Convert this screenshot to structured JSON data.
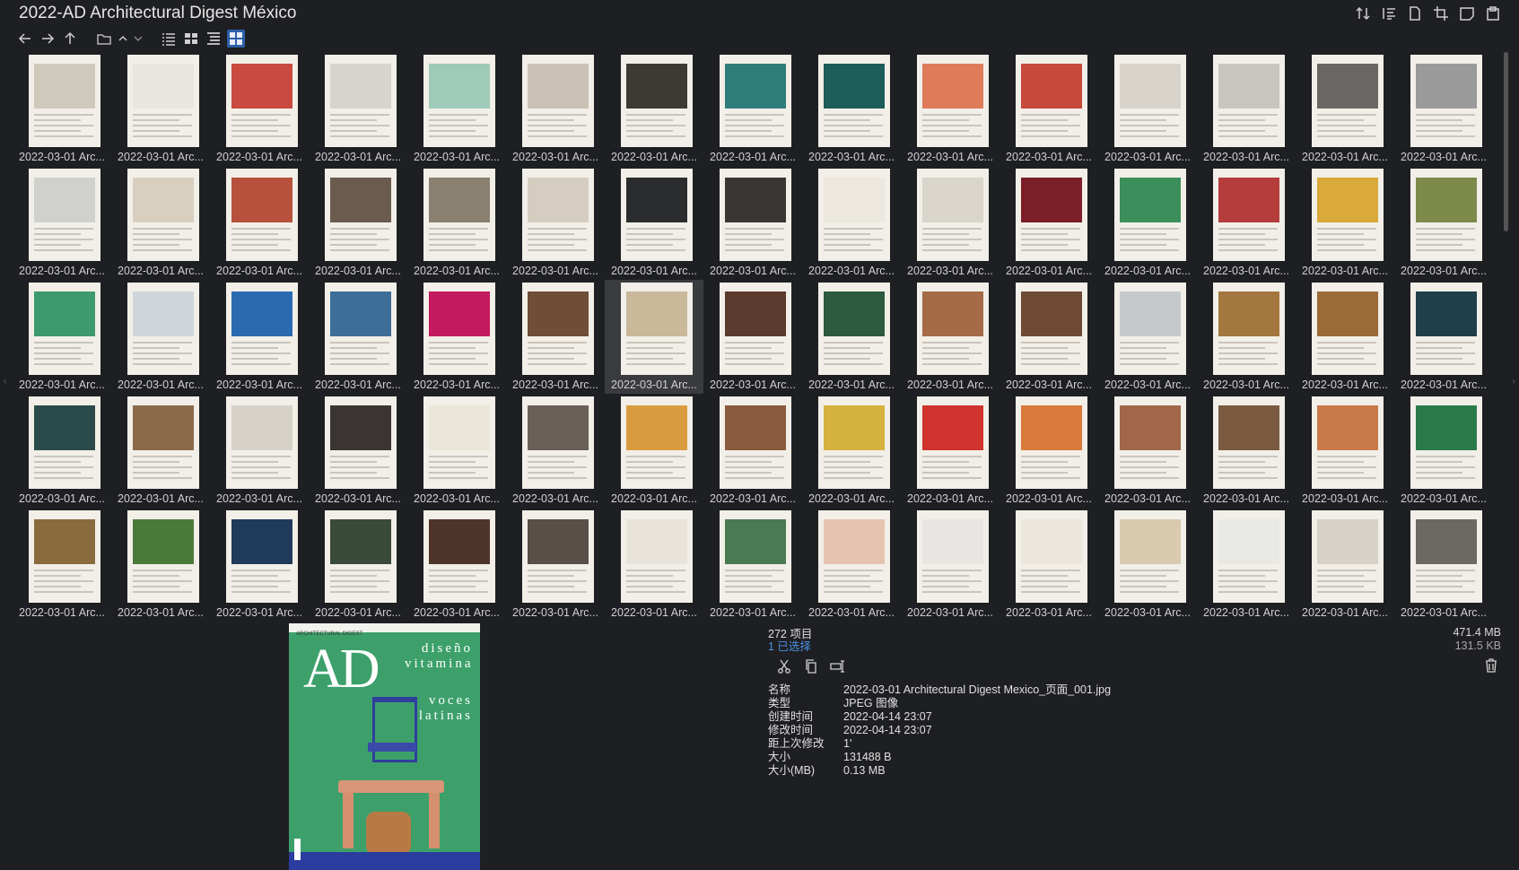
{
  "window": {
    "title": "2022-AD Architectural Digest México"
  },
  "top_icons": [
    "sort-icon",
    "sort-list-icon",
    "page-icon",
    "crop-icon",
    "tab-icon",
    "clipboard-icon"
  ],
  "toolbar": {
    "nav": [
      "arrow-left-icon",
      "arrow-right-icon",
      "arrow-up-icon"
    ],
    "folder": [
      "folder-icon",
      "chevron-up-icon",
      "chevron-down-icon"
    ],
    "views": [
      "view-list-icon",
      "view-details-icon",
      "view-tree-icon",
      "view-grid-icon"
    ],
    "active_view": "view-grid-icon"
  },
  "grid": {
    "caption": "2022-03-01 Arc...",
    "selected_index": 36,
    "thumb_colors": [
      "#cfc9bc",
      "#e9e6e0",
      "#c94a3f",
      "#d6d4cf",
      "#9fc9b8",
      "#c9c2b5",
      "#3d3a36",
      "#2f7d7a",
      "#1d5c5a",
      "#e07b5a",
      "#c64a3b",
      "#d8d4cc",
      "#c8c6c0",
      "#6a6663",
      "#9a9a9a",
      "#d0d0cc",
      "#d9cfbf",
      "#b7513c",
      "#6b5b4f",
      "#8a8070",
      "#d5cdbf",
      "#2a2c2d",
      "#3a3633",
      "#ece8df",
      "#d9d5cc",
      "#7a1e27",
      "#3c8f5a",
      "#b43c3a",
      "#d9a93a",
      "#7d8a4a",
      "#3c9a6e",
      "#cfd6db",
      "#2a6bb0",
      "#3d6e9a",
      "#c3195f",
      "#6e4e36",
      "#c9b89a",
      "#5a3a2c",
      "#2d5a3f",
      "#a56a46",
      "#6e4a36",
      "#c5c9cc",
      "#a3773f",
      "#9a6a37",
      "#1f3f4a",
      "#2b4b4a",
      "#8a6a48",
      "#d7d2c8",
      "#3a3532",
      "#ece6da",
      "#6b6058",
      "#d89c3f",
      "#8a5a3c",
      "#d6b23e",
      "#d0342f",
      "#d97a3c",
      "#a0674a",
      "#7a5a40",
      "#c97a4a",
      "#2a7a4a",
      "#8a6b3e",
      "#4a7a3a",
      "#1f3a5a",
      "#3a4a3a",
      "#4e3428",
      "#5a4e48",
      "#e8e4dc",
      "#4a7a52",
      "#e6c3b0",
      "#e8e6e2",
      "#ece6dc",
      "#d9cab0",
      "#e8e8e4",
      "#d7d1c7",
      "#6a6a62"
    ]
  },
  "preview": {
    "masthead": "ARCHITECTURAL DIGEST",
    "logo": "AD",
    "right_big": [
      "diseño",
      "vitamina",
      "voces",
      "latinas"
    ]
  },
  "info": {
    "count": "272 项目",
    "selected": "1 已选择",
    "actions": [
      "scissors-icon",
      "copy-icon",
      "rename-icon"
    ],
    "size_total": "471.4 MB",
    "size_sel": "131.5 KB",
    "props": [
      {
        "k": "名称",
        "v": "2022-03-01 Architectural Digest Mexico_页面_001.jpg"
      },
      {
        "k": "类型",
        "v": "JPEG 图像"
      },
      {
        "k": "创建时间",
        "v": "2022-04-14  23:07"
      },
      {
        "k": "修改时间",
        "v": "2022-04-14  23:07"
      },
      {
        "k": "距上次修改",
        "v": "1'"
      },
      {
        "k": "大小",
        "v": "131488 B"
      },
      {
        "k": "大小(MB)",
        "v": "0.13 MB"
      }
    ]
  }
}
